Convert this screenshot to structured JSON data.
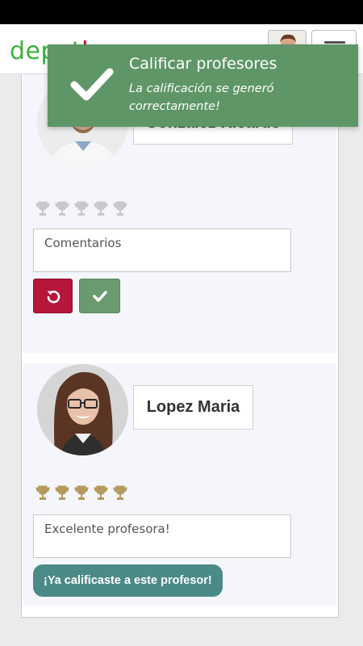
{
  "header": {
    "logo_text": "depo",
    "logo_tail": "t",
    "logo_accent": "l",
    "avatar_icon": "user-avatar",
    "menu_icon": "hamburger-menu-icon"
  },
  "colors": {
    "brand_green": "#3cb43c",
    "toast_bg": "#5f9667",
    "reset_button": "#b5163a",
    "confirm_button": "#6a9a70",
    "rated_button": "#4a8a87",
    "trophy_inactive": "#c8c8c8",
    "trophy_active": "#b59a5f"
  },
  "toast": {
    "title": "Calificar profesores",
    "message": "La calificación se generó correctamente!",
    "icon": "checkmark-icon"
  },
  "professors": [
    {
      "name": "Gonzalez Ricardo",
      "rating": 0,
      "max_rating": 5,
      "comment_placeholder": "Comentarios",
      "comment_value": "",
      "reset_icon": "undo-icon",
      "confirm_icon": "checkmark-icon"
    },
    {
      "name": "Lopez Maria",
      "rating": 5,
      "max_rating": 5,
      "comment_placeholder": "",
      "comment_value": "Excelente profesora!",
      "rated_label": "¡Ya calificaste a este profesor!"
    }
  ]
}
